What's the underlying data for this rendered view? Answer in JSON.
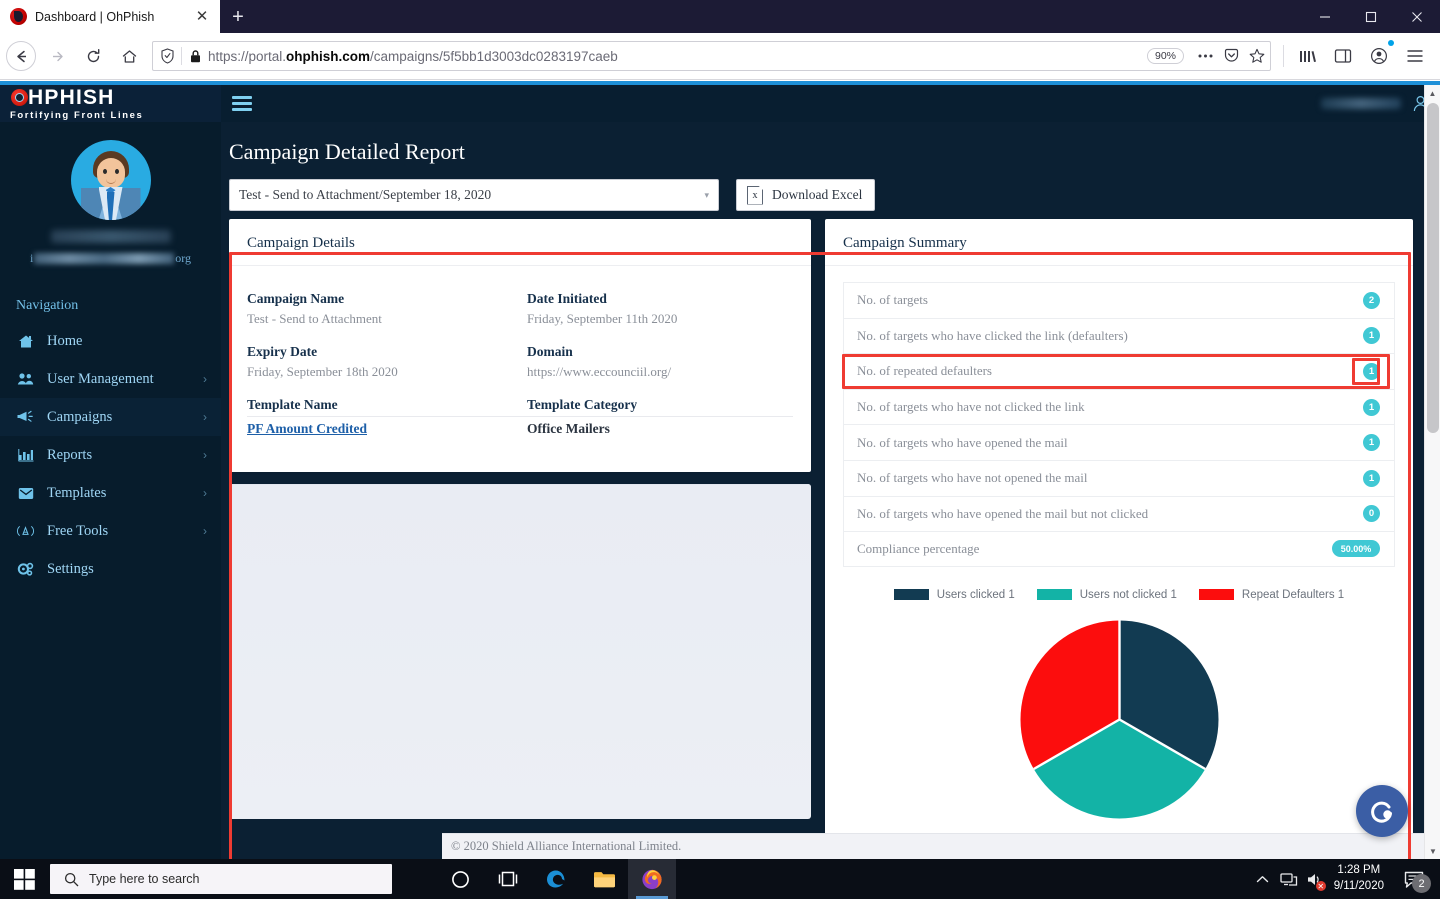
{
  "browser": {
    "tab_title": "Dashboard | OhPhish",
    "tab_close": "✕",
    "newtab_label": "+",
    "url_scheme": "https://portal.",
    "url_domain": "ohphish.com",
    "url_path": "/campaigns/5f5bb1d3003dc0283197caeb",
    "zoom_level": "90%",
    "win_minimize": "—",
    "win_maximize": "▢",
    "win_close": "✕"
  },
  "sidebar": {
    "brand_name": "HPHISH",
    "brand_tagline": "Fortifying Front Lines",
    "user_email_suffix": "org",
    "nav_heading": "Navigation",
    "items": [
      {
        "label": "Home",
        "icon": "home-icon",
        "arrow": ""
      },
      {
        "label": "User Management",
        "icon": "users-icon",
        "arrow": "›"
      },
      {
        "label": "Campaigns",
        "icon": "megaphone-icon",
        "arrow": "›"
      },
      {
        "label": "Reports",
        "icon": "bar-chart-icon",
        "arrow": "›"
      },
      {
        "label": "Templates",
        "icon": "envelope-icon",
        "arrow": "›"
      },
      {
        "label": "Free Tools",
        "icon": "tools-icon",
        "arrow": "›"
      },
      {
        "label": "Settings",
        "icon": "gear-icon",
        "arrow": ""
      }
    ]
  },
  "header": {
    "page_title": "Campaign Detailed Report",
    "campaign_select_value": "Test - Send to Attachment/September 18, 2020",
    "select_caret": "▾",
    "download_label": "Download Excel",
    "excel_glyph": "x"
  },
  "campaign_details": {
    "panel_title": "Campaign Details",
    "fields": [
      {
        "label": "Campaign Name",
        "value": "Test - Send to Attachment"
      },
      {
        "label": "Date Initiated",
        "value": "Friday, September 11th 2020"
      },
      {
        "label": "Expiry Date",
        "value": "Friday, September 18th 2020"
      },
      {
        "label": "Domain",
        "value": "https://www.eccounciil.org/"
      },
      {
        "label": "Template Name",
        "value": "PF Amount Credited"
      },
      {
        "label": "Template Category",
        "value": "Office Mailers"
      }
    ]
  },
  "campaign_summary": {
    "panel_title": "Campaign Summary",
    "rows": [
      {
        "label": "No. of targets",
        "value": "2"
      },
      {
        "label": "No. of targets who have clicked the link (defaulters)",
        "value": "1"
      },
      {
        "label": "No. of repeated defaulters",
        "value": "1"
      },
      {
        "label": "No. of targets who have not clicked the link",
        "value": "1"
      },
      {
        "label": "No. of targets who have opened the mail",
        "value": "1"
      },
      {
        "label": "No. of targets who have not opened the mail",
        "value": "1"
      },
      {
        "label": "No. of targets who have opened the mail but not clicked",
        "value": "0"
      },
      {
        "label": "Compliance percentage",
        "value": "50.00%"
      }
    ]
  },
  "chart_data": {
    "type": "pie",
    "title": "",
    "labels": [
      "Users clicked",
      "Users not clicked",
      "Repeat Defaulters"
    ],
    "legend_entries": [
      "Users clicked 1",
      "Users not clicked 1",
      "Repeat Defaulters 1"
    ],
    "values": [
      1,
      1,
      1
    ],
    "percentages": [
      33.33,
      33.33,
      33.33
    ],
    "colors": [
      "#123b52",
      "#13b3a6",
      "#fc0d0d"
    ],
    "legend_position": "top"
  },
  "footer": {
    "copyright": "© 2020 Shield Alliance International Limited."
  },
  "taskbar": {
    "search_placeholder": "Type here to search",
    "time": "1:28 PM",
    "date": "9/11/2020",
    "notification_count": "2",
    "tray_chevron": "⌃"
  },
  "colors": {
    "accent_blue": "#1e90d8",
    "sidebar_bg": "#071c2c",
    "badge_teal": "#40c8d4",
    "highlight_red": "#ef3b32"
  }
}
